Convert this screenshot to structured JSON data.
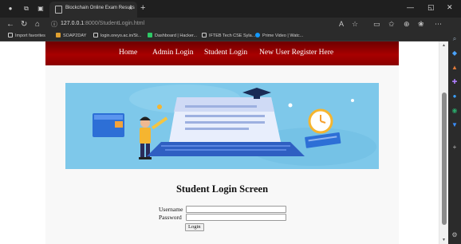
{
  "browser": {
    "tab_title": "Blockchain Online Exam Results",
    "url_host": "127.0.0.1",
    "url_rest": ":8000/StudentLogin.html",
    "bookmarks": [
      {
        "label": "Import favorites",
        "color": "#cfcfcf"
      },
      {
        "label": "SOAP2DAY",
        "color": "#e0a030"
      },
      {
        "label": "login.oreyo.ac.in/St...",
        "color": "#cfcfcf"
      },
      {
        "label": "Dashboard | Hacker...",
        "color": "#2ec866"
      },
      {
        "label": "IFTEB Tech CSE Syla...",
        "color": "#cfcfcf"
      },
      {
        "label": "Prime Video | Watc...",
        "color": "#1399ff"
      }
    ]
  },
  "site": {
    "nav": [
      "Home",
      "Admin Login",
      "Student Login",
      "New User Register Here"
    ],
    "accent": "#a80000"
  },
  "login": {
    "title": "Student Login Screen",
    "username_label": "Username",
    "password_label": "Password",
    "username_value": "",
    "password_value": "",
    "submit_label": "Login"
  },
  "icons": [
    "back-icon",
    "refresh-icon",
    "home-icon",
    "info-icon",
    "favorite-star-icon",
    "collections-icon",
    "settings-more-icon",
    "search-icon"
  ]
}
